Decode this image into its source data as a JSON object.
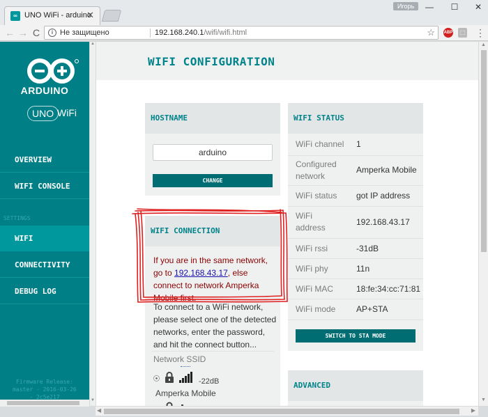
{
  "browser": {
    "tab_title": "UNO WiFi - arduino",
    "tab_icon_text": "∞",
    "tab_close": "✕",
    "user_name": "Игорь",
    "win_minimize": "—",
    "win_maximize": "☐",
    "win_close": "✕",
    "nav_back": "←",
    "nav_forward": "→",
    "nav_reload": "C",
    "security_label": "Не защищено",
    "url_host": "192.168.240.1",
    "url_path": "/wifi/wifi.html",
    "star": "☆",
    "ext_abp": "ABP",
    "ext_pdf": "⬚",
    "menu": "⋮"
  },
  "sidebar": {
    "brand": "ARDUINO",
    "uno_badge": "UNO",
    "wifi_label": "WiFi",
    "settings_label": "SETTINGS",
    "items": [
      {
        "label": "OVERVIEW"
      },
      {
        "label": "WIFI CONSOLE"
      },
      {
        "label": "WIFI"
      },
      {
        "label": "CONNECTIVITY"
      },
      {
        "label": "DEBUG LOG"
      }
    ],
    "firmware": [
      "Firmware Release:",
      "master - 2016-03-26",
      "- 2c5e217"
    ]
  },
  "main": {
    "title": "WIFI CONFIGURATION",
    "hostname": {
      "heading": "HOSTNAME",
      "value": "arduino",
      "button": "CHANGE"
    },
    "connection": {
      "heading": "WIFI CONNECTION",
      "notice_pre": "If you are in the same network, go to",
      "notice_link": "192.168.43.17",
      "notice_post": ", else connect to network Amperka Mobile first.",
      "instructions": "To connect to a WiFi network, please select one of the detected networks, enter the password, and hit the connect button...",
      "ssid_label": "Network SSID",
      "networks": [
        {
          "rssi": "-22dB",
          "name": "Amperka Mobile"
        }
      ]
    },
    "status": {
      "heading": "WIFI STATUS",
      "rows": [
        {
          "key": "WiFi channel",
          "value": "1"
        },
        {
          "key": "Configured network",
          "value": "Amperka Mobile"
        },
        {
          "key": "WiFi status",
          "value": "got IP address"
        },
        {
          "key": "WiFi address",
          "value": "192.168.43.17"
        },
        {
          "key": "WiFi rssi",
          "value": "-31dB"
        },
        {
          "key": "WiFi phy",
          "value": "11n"
        },
        {
          "key": "WiFi MAC",
          "value": "18:fe:34:cc:71:81"
        },
        {
          "key": "WiFi mode",
          "value": "AP+STA"
        }
      ],
      "button": "SWITCH TO STA MODE"
    },
    "advanced": {
      "heading": "ADVANCED"
    }
  },
  "colors": {
    "teal": "#007f86",
    "teal_active": "#00979d",
    "annotation_red": "#e02020"
  }
}
